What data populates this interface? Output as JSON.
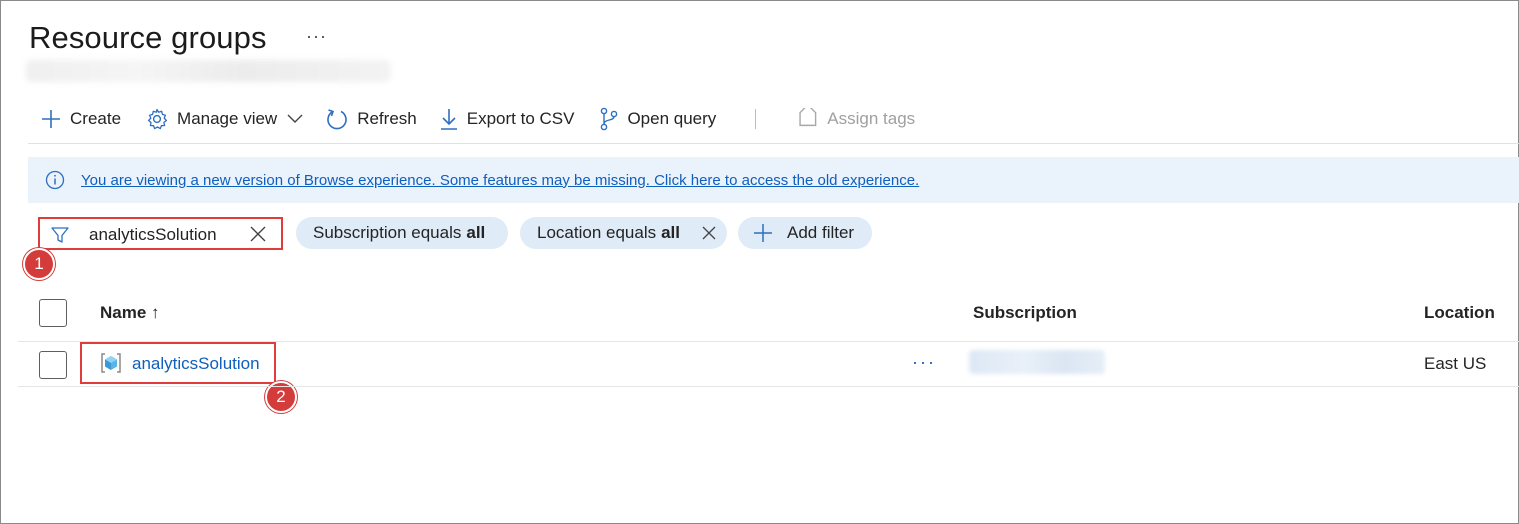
{
  "page": {
    "title": "Resource groups",
    "more_label": "···"
  },
  "toolbar": {
    "create": "Create",
    "manage_view": "Manage view",
    "refresh": "Refresh",
    "export_csv": "Export to CSV",
    "open_query": "Open query",
    "assign_tags": "Assign tags"
  },
  "banner": {
    "text": "You are viewing a new version of Browse experience. Some features may be missing. Click here to access the old experience."
  },
  "filters": {
    "search_value": "analyticsSolution",
    "subscription_label": "Subscription equals",
    "subscription_value": "all",
    "location_label": "Location equals",
    "location_value": "all",
    "add_filter": "Add filter"
  },
  "callouts": [
    "1",
    "2"
  ],
  "table": {
    "columns": {
      "name": "Name ↑",
      "subscription": "Subscription",
      "location": "Location"
    },
    "rows": [
      {
        "name": "analyticsSolution",
        "more": "···",
        "location": "East US"
      }
    ]
  },
  "colors": {
    "accent": "#0f5fbf",
    "highlight": "#e03c3c",
    "banner_bg": "#eaf2fb",
    "pill_bg": "#dfebf7"
  }
}
